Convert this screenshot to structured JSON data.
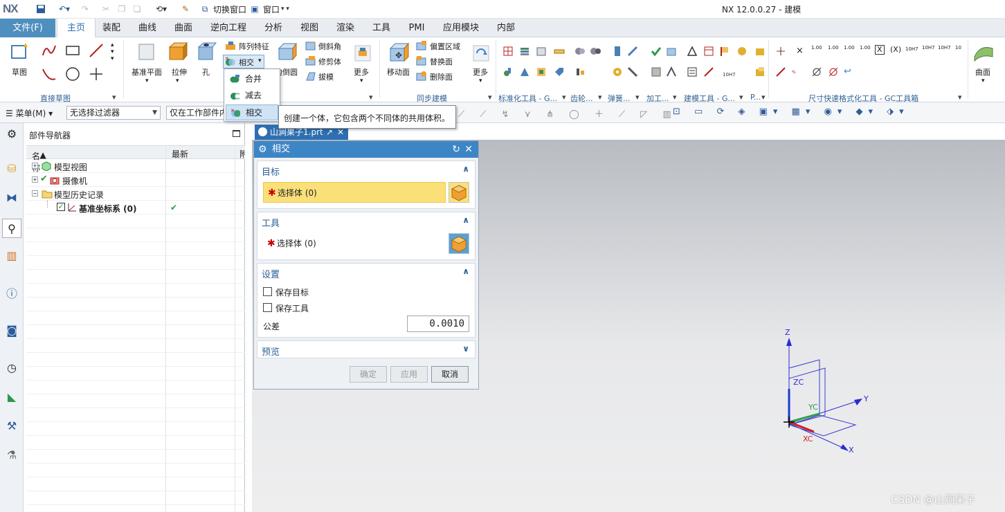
{
  "titlebar": {
    "logo": "NX",
    "switch_window": "切换窗口",
    "window": "窗口",
    "app_title": "NX 12.0.0.27 - 建模"
  },
  "tabs": {
    "file": "文件(F)",
    "items": [
      "主页",
      "装配",
      "曲线",
      "曲面",
      "逆向工程",
      "分析",
      "视图",
      "渲染",
      "工具",
      "PMI",
      "应用模块",
      "内部"
    ],
    "active": "主页"
  },
  "ribbon": {
    "sketch": "草图",
    "datum_plane": "基准平面",
    "extrude": "拉伸",
    "hole": "孔",
    "pattern_feature": "阵列特征",
    "intersect_split": "相交",
    "edge_blend": "边倒圆",
    "chamfer": "倒斜角",
    "trim_body": "修剪体",
    "draft": "拔模",
    "more1": "更多",
    "move_face": "移动面",
    "offset_region": "偏置区域",
    "replace_face": "替换面",
    "delete_face": "删除面",
    "more2": "更多",
    "surface": "曲面",
    "groups": {
      "direct_sketch": "直接草图",
      "sync_modeling": "同步建模",
      "standard_tools": "标准化工具 - G...",
      "gear": "齿轮...",
      "spring": "弹簧...",
      "machining": "加工...",
      "modeling_tools": "建模工具 - G...",
      "p": "P...",
      "dimension_tools": "尺寸快速格式化工具 - GC工具箱"
    },
    "dim_labels": [
      "1.00",
      "1.00",
      "1.00",
      "1.00",
      "10H7",
      "10H7",
      "10H7",
      "10"
    ]
  },
  "selbar": {
    "menu": "菜单(M)",
    "filter": "无选择过滤器",
    "scope": "仅在工作部件内"
  },
  "dropdown": {
    "items": [
      {
        "label": "合并",
        "highlighted": false
      },
      {
        "label": "减去",
        "highlighted": false
      },
      {
        "label": "相交",
        "highlighted": true
      }
    ]
  },
  "tooltip": "创建一个体，它包含两个不同体的共用体积。",
  "navigator": {
    "title": "部件导航器",
    "columns": [
      "名称",
      "最新",
      "附"
    ],
    "rows": [
      {
        "label": "模型视图",
        "bold": false,
        "latest": ""
      },
      {
        "label": "摄像机",
        "bold": false,
        "latest": ""
      },
      {
        "label": "模型历史记录",
        "bold": false,
        "latest": ""
      },
      {
        "label": "基准坐标系 (0)",
        "bold": true,
        "latest": "✔"
      }
    ]
  },
  "doc_tab": "山涧果子1.prt",
  "dialog": {
    "title": "相交",
    "target": {
      "header": "目标",
      "select": "选择体 (0)"
    },
    "tool": {
      "header": "工具",
      "select": "选择体 (0)"
    },
    "settings": {
      "header": "设置",
      "keep_target": "保存目标",
      "keep_tool": "保存工具",
      "tolerance_label": "公差",
      "tolerance_value": "0.0010"
    },
    "preview": {
      "header": "预览"
    },
    "buttons": {
      "ok": "确定",
      "apply": "应用",
      "cancel": "取消"
    }
  },
  "triad": {
    "z": "Z",
    "y": "Y",
    "x": "X",
    "zc": "ZC",
    "yc": "YC",
    "xc": "XC"
  },
  "watermark": "CSDN @山涧果子",
  "colors": {
    "accent": "#3d86c6",
    "file_tab": "#4f8fbf",
    "highlight_row": "#fbe07a",
    "required_star": "#cc0000"
  }
}
